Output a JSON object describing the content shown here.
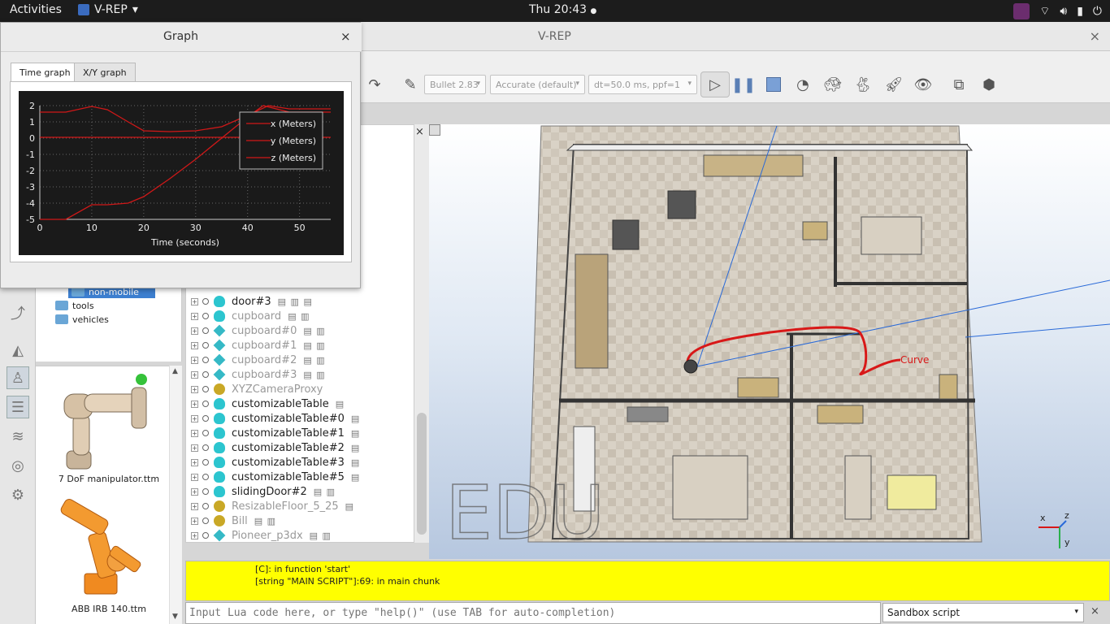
{
  "topbar": {
    "activities": "Activities",
    "app_name": "V-REP",
    "app_arrow": "▾",
    "clock": "Thu 20:43",
    "clock_dot": "●",
    "tray_icons": [
      "slack-icon",
      "wifi-icon",
      "volume-icon",
      "battery-icon",
      "power-icon"
    ]
  },
  "window": {
    "title": "V-REP",
    "close": "×"
  },
  "toolbar": {
    "engine": "Bullet 2.83",
    "accuracy": "Accurate (default)",
    "timestep": "dt=50.0 ms, ppf=1",
    "arrow": "▾"
  },
  "graph_dialog": {
    "title": "Graph",
    "close": "×",
    "tabs": [
      "Time graph",
      "X/Y graph"
    ],
    "active_tab": 0
  },
  "chart_data": {
    "type": "line",
    "xlabel": "Time (seconds)",
    "xlim": [
      0,
      56
    ],
    "ylim": [
      -5,
      2
    ],
    "x_ticks": [
      "0",
      "10",
      "20",
      "30",
      "40",
      "50"
    ],
    "y_ticks": [
      "2",
      "1",
      "0",
      "-1",
      "-2",
      "-3",
      "-4",
      "-5"
    ],
    "grid": true,
    "legend_position": "top-right",
    "series": [
      {
        "name": "x (Meters)",
        "color": "#d01818",
        "x": [
          0,
          5,
          10,
          13,
          17,
          20,
          25,
          30,
          35,
          40,
          44,
          48,
          56
        ],
        "y": [
          1.6,
          1.6,
          1.95,
          1.75,
          1.0,
          0.45,
          0.4,
          0.45,
          0.7,
          1.4,
          2.0,
          1.8,
          1.8
        ]
      },
      {
        "name": "y (Meters)",
        "color": "#d01818",
        "x": [
          0,
          56
        ],
        "y": [
          0.05,
          0.05
        ]
      },
      {
        "name": "z (Meters)",
        "color": "#d01818",
        "x": [
          0,
          5,
          10,
          13,
          17,
          20,
          25,
          30,
          35,
          40,
          43,
          48,
          56
        ],
        "y": [
          -5.0,
          -5.0,
          -4.1,
          -4.1,
          -4.0,
          -3.6,
          -2.5,
          -1.3,
          0.0,
          1.3,
          2.0,
          1.6,
          1.6
        ]
      }
    ]
  },
  "model_browser": {
    "folders": [
      {
        "label": "non-mobile",
        "selected": true
      },
      {
        "label": "tools",
        "selected": false
      },
      {
        "label": "vehicles",
        "selected": false
      }
    ],
    "thumbnails": [
      "7 DoF manipulator.ttm",
      "ABB IRB 140.ttm"
    ],
    "scroll_up": "▲",
    "scroll_down": "▼"
  },
  "hierarchy": {
    "close": "×",
    "rows": [
      {
        "name": "door#3",
        "icon": "shape-icon",
        "dim": false,
        "extra": "▤ ▥ ▤"
      },
      {
        "name": "cupboard",
        "icon": "shape-icon",
        "dim": true,
        "extra": "▤ ▥"
      },
      {
        "name": "cupboard#0",
        "icon": "cube-icon",
        "dim": true,
        "extra": "▤ ▥"
      },
      {
        "name": "cupboard#1",
        "icon": "cube-icon",
        "dim": true,
        "extra": "▤ ▥"
      },
      {
        "name": "cupboard#2",
        "icon": "cube-icon",
        "dim": true,
        "extra": "▤ ▥"
      },
      {
        "name": "cupboard#3",
        "icon": "cube-icon",
        "dim": true,
        "extra": "▤ ▥"
      },
      {
        "name": "XYZCameraProxy",
        "icon": "camera-icon",
        "dim": true,
        "extra": ""
      },
      {
        "name": "customizableTable",
        "icon": "shape-icon",
        "dim": false,
        "extra": "▤"
      },
      {
        "name": "customizableTable#0",
        "icon": "shape-icon",
        "dim": false,
        "extra": "▤"
      },
      {
        "name": "customizableTable#1",
        "icon": "shape-icon",
        "dim": false,
        "extra": "▤"
      },
      {
        "name": "customizableTable#2",
        "icon": "shape-icon",
        "dim": false,
        "extra": "▤"
      },
      {
        "name": "customizableTable#3",
        "icon": "shape-icon",
        "dim": false,
        "extra": "▤"
      },
      {
        "name": "customizableTable#5",
        "icon": "shape-icon",
        "dim": false,
        "extra": "▤"
      },
      {
        "name": "slidingDoor#2",
        "icon": "shape-icon",
        "dim": false,
        "extra": "▤ ▥"
      },
      {
        "name": "ResizableFloor_5_25",
        "icon": "camera-icon",
        "dim": true,
        "extra": "▤"
      },
      {
        "name": "Bill",
        "icon": "camera-icon",
        "dim": true,
        "extra": "▤ ▥"
      },
      {
        "name": "Pioneer_p3dx",
        "icon": "cube-icon",
        "dim": true,
        "extra": "▤ ▥"
      }
    ]
  },
  "scene": {
    "curve_label": "Curve",
    "watermark": "EDU",
    "axis_x": "x",
    "axis_y": "y",
    "axis_z": "z"
  },
  "console": {
    "line1": "[C]: in function 'start'",
    "line2": "[string \"MAIN SCRIPT\"]:69: in main chunk",
    "input_placeholder": "Input Lua code here, or type \"help()\" (use TAB for auto-completion)",
    "script_select": "Sandbox script",
    "arrow": "▾",
    "close": "×"
  }
}
